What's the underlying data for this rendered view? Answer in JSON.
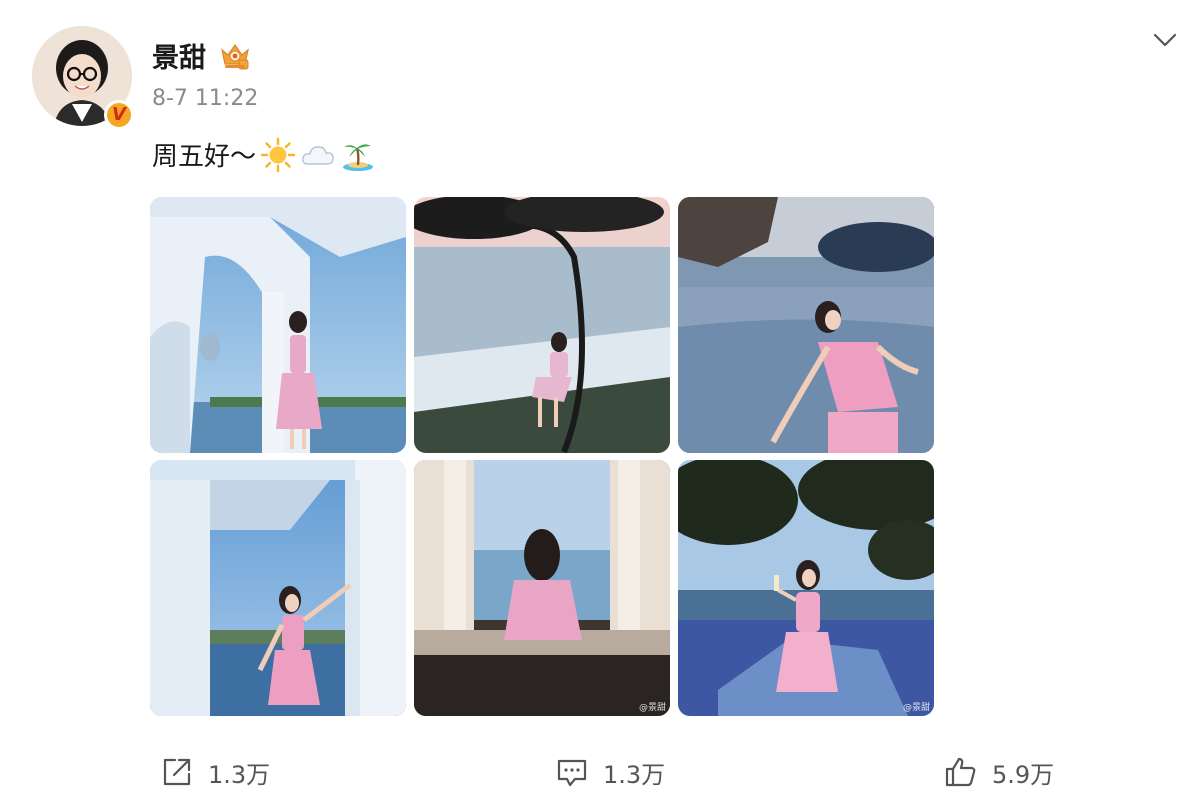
{
  "user": {
    "name": "景甜",
    "timestamp": "8-7 11:22",
    "verified_badge_letter": "V",
    "member_icon": "vip-crown-icon"
  },
  "post": {
    "text": "周五好～",
    "emojis": [
      "sun-emoji",
      "cloud-emoji",
      "island-emoji"
    ]
  },
  "photos": [
    {
      "name": "photo-1",
      "watermark": ""
    },
    {
      "name": "photo-2",
      "watermark": ""
    },
    {
      "name": "photo-3",
      "watermark": ""
    },
    {
      "name": "photo-4",
      "watermark": ""
    },
    {
      "name": "photo-5",
      "watermark": "@景甜"
    },
    {
      "name": "photo-6",
      "watermark": "@景甜"
    }
  ],
  "actions": {
    "repost_count": "1.3万",
    "comment_count": "1.3万",
    "like_count": "5.9万"
  },
  "colors": {
    "text": "#1a1a1a",
    "muted": "#8a8a8a",
    "badge": "#f5a623"
  }
}
